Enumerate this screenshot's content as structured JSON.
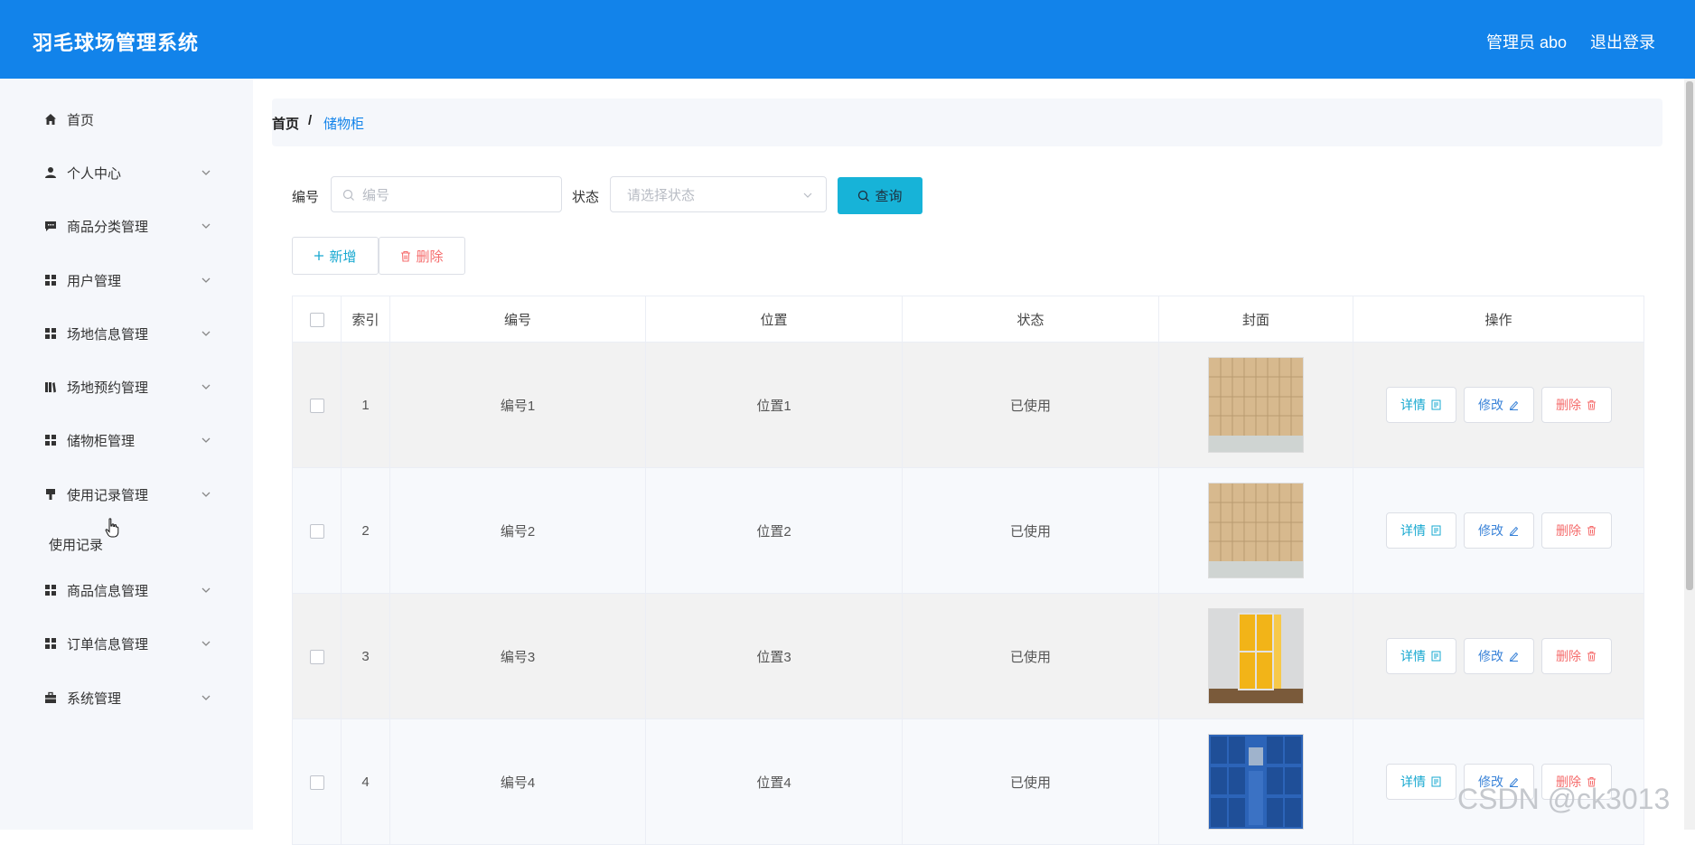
{
  "header": {
    "title": "羽毛球场管理系统",
    "admin": "管理员 abo",
    "logout": "退出登录"
  },
  "sidebar": {
    "items": [
      {
        "label": "首页",
        "icon": "home-icon"
      },
      {
        "label": "个人中心",
        "icon": "user-icon"
      },
      {
        "label": "商品分类管理",
        "icon": "chat-icon"
      },
      {
        "label": "用户管理",
        "icon": "grid-icon"
      },
      {
        "label": "场地信息管理",
        "icon": "grid-icon"
      },
      {
        "label": "场地预约管理",
        "icon": "book-icon"
      },
      {
        "label": "储物柜管理",
        "icon": "grid-icon"
      },
      {
        "label": "使用记录管理",
        "icon": "brush-icon"
      },
      {
        "label": "商品信息管理",
        "icon": "grid-icon"
      },
      {
        "label": "订单信息管理",
        "icon": "grid-icon"
      },
      {
        "label": "系统管理",
        "icon": "briefcase-icon"
      }
    ],
    "sub_item": "使用记录"
  },
  "breadcrumb": {
    "home": "首页",
    "sep": "/",
    "current": "储物柜"
  },
  "search": {
    "number_label": "编号",
    "number_placeholder": "编号",
    "status_label": "状态",
    "status_placeholder": "请选择状态",
    "query": "查询"
  },
  "actions": {
    "add": "新增",
    "delete": "删除"
  },
  "table": {
    "headers": [
      "索引",
      "编号",
      "位置",
      "状态",
      "封面",
      "操作"
    ],
    "rows": [
      {
        "index": "1",
        "number": "编号1",
        "location": "位置1",
        "status": "已使用",
        "cover": "beige"
      },
      {
        "index": "2",
        "number": "编号2",
        "location": "位置2",
        "status": "已使用",
        "cover": "beige"
      },
      {
        "index": "3",
        "number": "编号3",
        "location": "位置3",
        "status": "已使用",
        "cover": "yellow"
      },
      {
        "index": "4",
        "number": "编号4",
        "location": "位置4",
        "status": "已使用",
        "cover": "blue"
      }
    ],
    "op_detail": "详情",
    "op_edit": "修改",
    "op_delete": "删除"
  },
  "watermark": "CSDN @ck3013",
  "colors": {
    "primary": "#1283ea",
    "query": "#17b3d8",
    "danger": "#f56c6c"
  }
}
